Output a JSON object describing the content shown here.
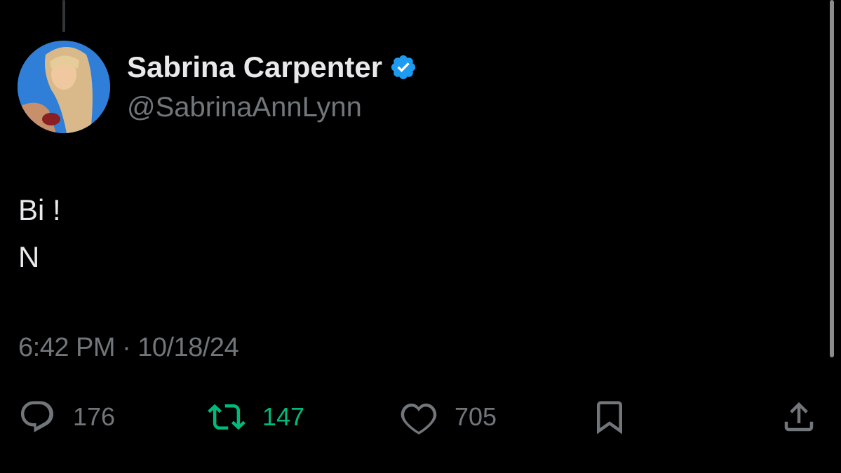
{
  "author": {
    "display_name": "Sabrina Carpenter",
    "handle": "@SabrinaAnnLynn",
    "verified": true,
    "verified_color": "#1d9bf0"
  },
  "tweet": {
    "lines": [
      "Bi !",
      "N"
    ],
    "timestamp": "6:42 PM · 10/18/24"
  },
  "actions": {
    "reply": {
      "icon": "reply-icon",
      "count": "176"
    },
    "retweet": {
      "icon": "retweet-icon",
      "count": "147",
      "active_color": "#00ba7c"
    },
    "like": {
      "icon": "heart-icon",
      "count": "705"
    },
    "bookmark": {
      "icon": "bookmark-icon"
    },
    "share": {
      "icon": "share-icon"
    }
  },
  "colors": {
    "background": "#000000",
    "primary_text": "#e7e9ea",
    "secondary_text": "#71767b"
  }
}
